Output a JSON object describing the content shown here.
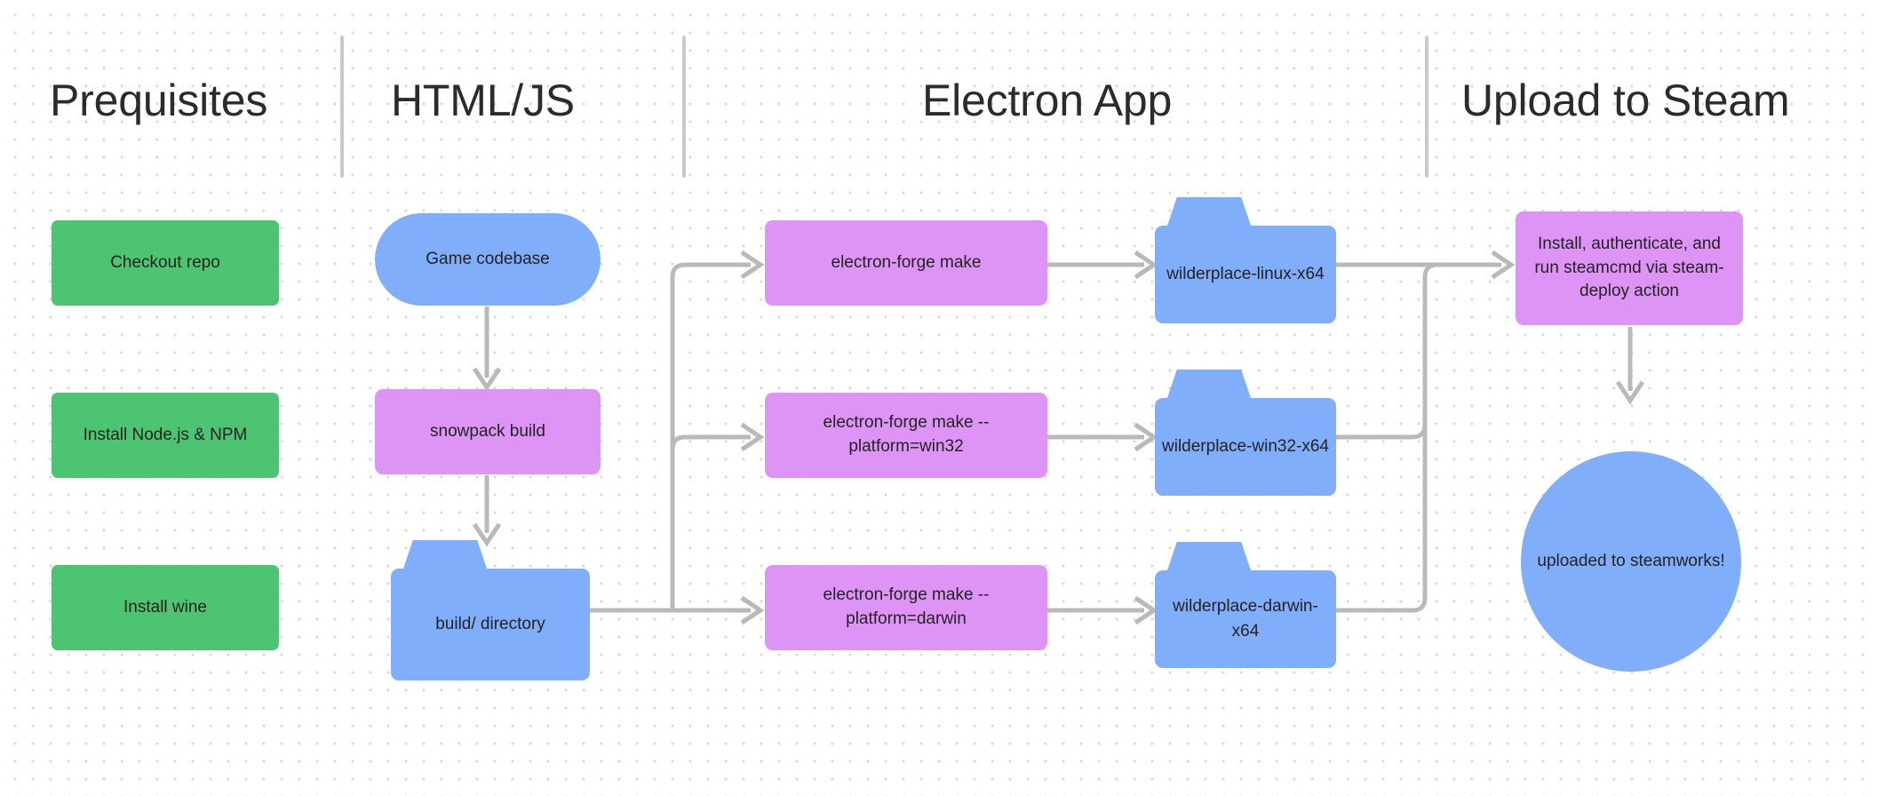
{
  "diagram": {
    "title_columns": [
      {
        "label": "Prequisites"
      },
      {
        "label": "HTML/JS"
      },
      {
        "label": "Electron App"
      },
      {
        "label": "Upload to Steam"
      }
    ],
    "prerequisites": {
      "steps": [
        {
          "label": "Checkout repo",
          "color": "#4cc471"
        },
        {
          "label": "Install Node.js & NPM",
          "color": "#4cc471"
        },
        {
          "label": "Install wine",
          "color": "#4cc471"
        }
      ]
    },
    "htmljs": {
      "source": {
        "label": "Game codebase",
        "shape": "pill",
        "color": "#81aefa"
      },
      "build_step": {
        "label": "snowpack build",
        "shape": "rounded-rect",
        "color": "#dd94f5"
      },
      "output_dir": {
        "label": "build/ directory",
        "shape": "folder",
        "color": "#81aefa"
      }
    },
    "electron": {
      "commands": [
        {
          "label": "electron-forge make",
          "color": "#dd94f5"
        },
        {
          "label": "electron-forge make --platform=win32",
          "color": "#dd94f5"
        },
        {
          "label": "electron-forge make --platform=darwin",
          "color": "#dd94f5"
        }
      ],
      "artifacts": [
        {
          "label": "wilderplace-linux-x64",
          "shape": "folder",
          "color": "#81aefa"
        },
        {
          "label": "wilderplace-win32-x64",
          "shape": "folder",
          "color": "#81aefa"
        },
        {
          "label": "wilderplace-darwin-x64",
          "shape": "folder",
          "color": "#81aefa"
        }
      ]
    },
    "steam": {
      "action": {
        "label": "Install, authenticate, and run steamcmd via steam-deploy action",
        "color": "#dd94f5"
      },
      "result": {
        "label": "uploaded to steamworks!",
        "shape": "circle",
        "color": "#81aefa"
      }
    },
    "connector_color": "#b9b9b9",
    "divider_color": "#c9c9c9",
    "background_dot_color": "#d8d8d8"
  }
}
